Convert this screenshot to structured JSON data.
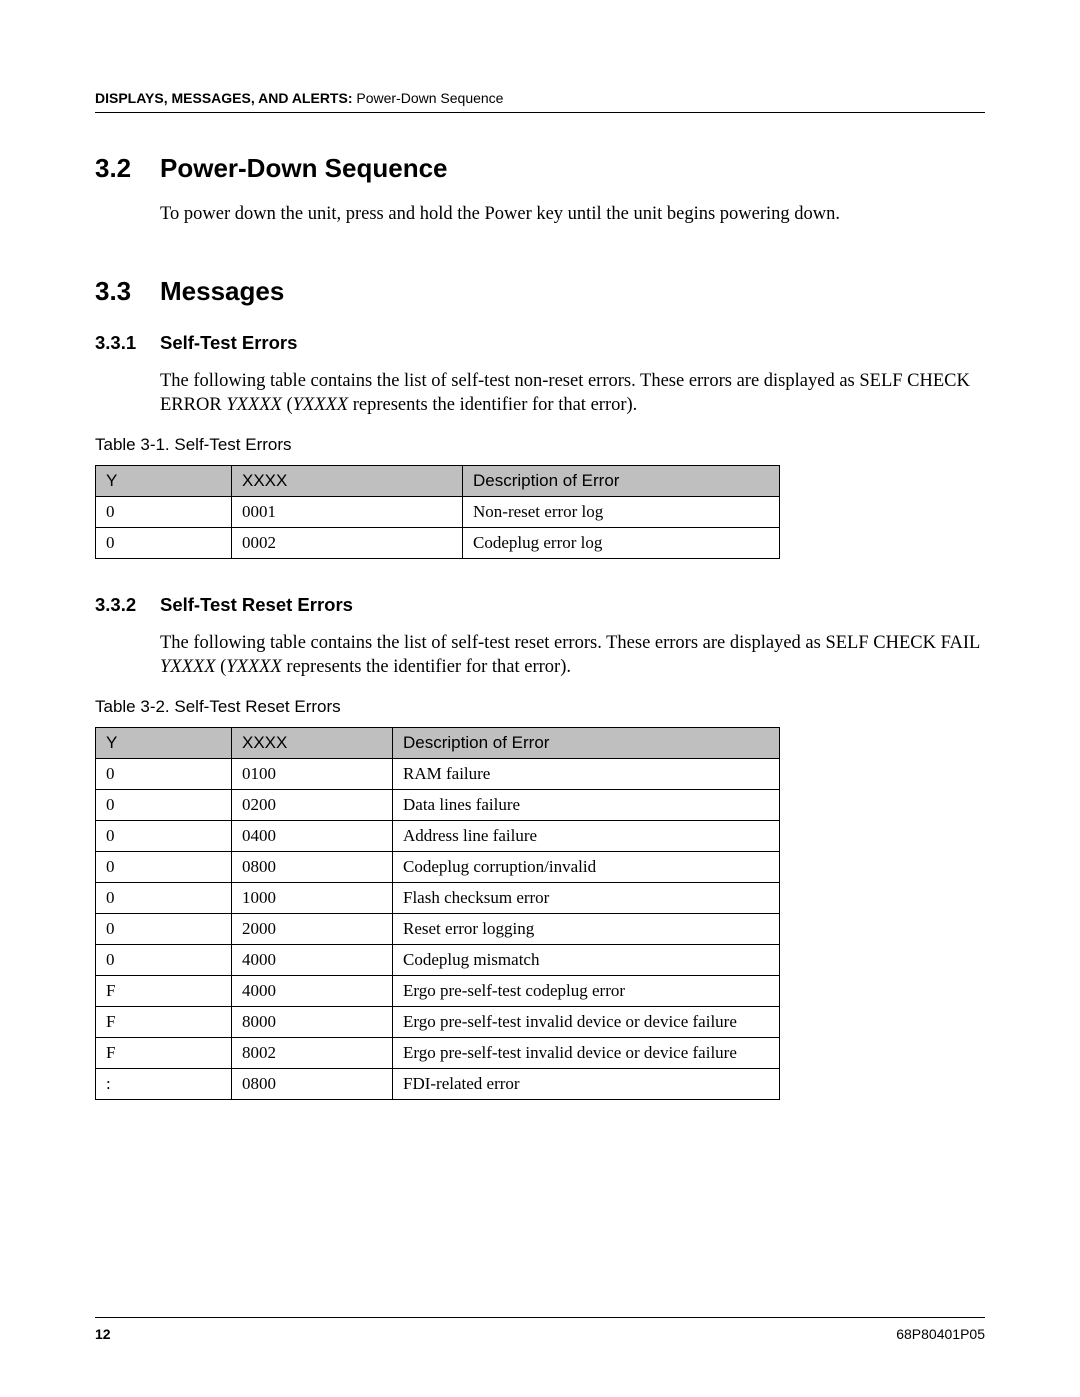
{
  "header": {
    "chapter": "DISPLAYS, MESSAGES, AND ALERTS:",
    "section": "Power-Down Sequence"
  },
  "sec32": {
    "num": "3.2",
    "title": "Power-Down Sequence",
    "body": "To power down the unit, press and hold the Power key until the unit begins powering down."
  },
  "sec33": {
    "num": "3.3",
    "title": "Messages"
  },
  "sec331": {
    "num": "3.3.1",
    "title": "Self-Test Errors",
    "body_part1": "The following table contains the list of self-test non-reset errors. These errors are displayed as SELF CHECK ERROR ",
    "body_ital1": "YXXXX",
    "body_part2": " (",
    "body_ital2": "YXXXX",
    "body_part3": " represents the identifier for that error)."
  },
  "table1": {
    "caption": "Table 3-1. Self-Test Errors",
    "headers": {
      "y": "Y",
      "x": "XXXX",
      "d": "Description of Error"
    },
    "rows": [
      {
        "y": "0",
        "x": "0001",
        "d": "Non-reset error log"
      },
      {
        "y": "0",
        "x": "0002",
        "d": "Codeplug error log"
      }
    ]
  },
  "sec332": {
    "num": "3.3.2",
    "title": "Self-Test Reset Errors",
    "body_part1": "The following table contains the list of self-test reset errors. These errors are displayed as SELF CHECK FAIL ",
    "body_ital1": "YXXXX",
    "body_part2": " (",
    "body_ital2": "YXXXX",
    "body_part3": " represents the identifier for that error)."
  },
  "table2": {
    "caption": "Table 3-2. Self-Test Reset Errors",
    "headers": {
      "y": "Y",
      "x": "XXXX",
      "d": "Description of Error"
    },
    "rows": [
      {
        "y": "0",
        "x": "0100",
        "d": "RAM failure"
      },
      {
        "y": "0",
        "x": "0200",
        "d": "Data lines failure"
      },
      {
        "y": "0",
        "x": "0400",
        "d": "Address line failure"
      },
      {
        "y": "0",
        "x": "0800",
        "d": "Codeplug corruption/invalid"
      },
      {
        "y": "0",
        "x": "1000",
        "d": "Flash checksum error"
      },
      {
        "y": "0",
        "x": "2000",
        "d": "Reset error logging"
      },
      {
        "y": "0",
        "x": "4000",
        "d": "Codeplug mismatch"
      },
      {
        "y": "F",
        "x": "4000",
        "d": "Ergo pre-self-test codeplug error"
      },
      {
        "y": "F",
        "x": "8000",
        "d": "Ergo pre-self-test invalid device or device failure"
      },
      {
        "y": "F",
        "x": "8002",
        "d": "Ergo pre-self-test invalid device or device failure"
      },
      {
        "y": ":",
        "x": "0800",
        "d": "FDI-related error"
      }
    ]
  },
  "footer": {
    "page": "12",
    "doc": "68P80401P05"
  }
}
